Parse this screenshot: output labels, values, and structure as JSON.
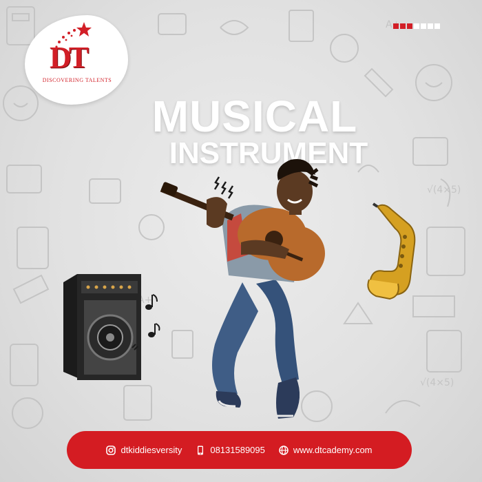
{
  "brand": {
    "logo_letters": "DT",
    "tagline": "DISCOVERING TALENTS",
    "red": "#d21f27"
  },
  "slide_indicator": {
    "active": 3,
    "total": 7
  },
  "headline": {
    "line1": "MUSICAL",
    "line2": "INSTRUMENT"
  },
  "contact": {
    "instagram": {
      "icon": "instagram-icon",
      "text": "dtkiddiesversity"
    },
    "phone": {
      "icon": "phone-icon",
      "text": "08131589095"
    },
    "website": {
      "icon": "globe-icon",
      "text": "www.dtcademy.com"
    }
  },
  "colors": {
    "background": "#e3e3e3",
    "accent": "#d41c22",
    "text": "#ffffff"
  }
}
